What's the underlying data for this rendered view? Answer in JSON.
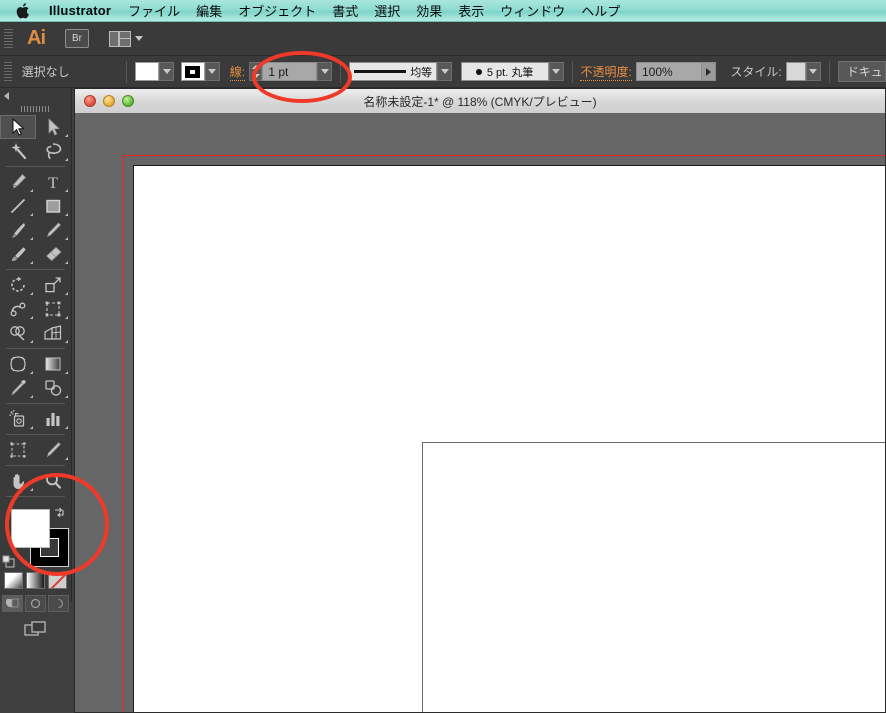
{
  "menubar": {
    "apple_icon": "apple-logo-icon",
    "app_name": "Illustrator",
    "items": [
      {
        "label": "ファイル"
      },
      {
        "label": "編集"
      },
      {
        "label": "オブジェクト"
      },
      {
        "label": "書式"
      },
      {
        "label": "選択"
      },
      {
        "label": "効果"
      },
      {
        "label": "表示"
      },
      {
        "label": "ウィンドウ"
      },
      {
        "label": "ヘルプ"
      }
    ]
  },
  "appbar": {
    "logo": "Ai",
    "bridge_label": "Br",
    "arrange_icon": "arrange-documents-icon"
  },
  "controlbar": {
    "selection_status": "選択なし",
    "fill_label": "fill-swatch",
    "stroke_swatch_label": "stroke-swatch",
    "stroke_label": "線:",
    "stroke_weight": "1 pt",
    "stroke_profile": "均等",
    "brush": "5 pt. 丸筆",
    "opacity_label": "不透明度:",
    "opacity_value": "100%",
    "style_label": "スタイル:",
    "document_button": "ドキュ"
  },
  "document": {
    "title": "名称未設定-1* @ 118% (CMYK/プレビュー)",
    "zoom": "118%",
    "color_mode": "CMYK",
    "view_mode": "プレビュー",
    "traffic_lights": [
      "close",
      "minimize",
      "zoom"
    ]
  },
  "tools": {
    "rows": [
      [
        {
          "name": "selection-tool",
          "active": true
        },
        {
          "name": "direct-selection-tool",
          "active": false
        }
      ],
      [
        {
          "name": "magic-wand-tool",
          "active": false
        },
        {
          "name": "lasso-tool",
          "active": false
        }
      ],
      [
        {
          "name": "pen-tool",
          "active": false
        },
        {
          "name": "type-tool",
          "active": false
        }
      ],
      [
        {
          "name": "line-segment-tool",
          "active": false
        },
        {
          "name": "rectangle-tool",
          "active": false
        }
      ],
      [
        {
          "name": "paintbrush-tool",
          "active": false
        },
        {
          "name": "pencil-tool",
          "active": false
        }
      ],
      [
        {
          "name": "blob-brush-tool",
          "active": false
        },
        {
          "name": "eraser-tool",
          "active": false
        }
      ],
      [
        {
          "name": "rotate-tool",
          "active": false
        },
        {
          "name": "scale-tool",
          "active": false
        }
      ],
      [
        {
          "name": "width-tool",
          "active": false
        },
        {
          "name": "free-transform-tool",
          "active": false
        }
      ],
      [
        {
          "name": "shape-builder-tool",
          "active": false
        },
        {
          "name": "perspective-grid-tool",
          "active": false
        }
      ],
      [
        {
          "name": "mesh-tool",
          "active": false
        },
        {
          "name": "gradient-tool",
          "active": false
        }
      ],
      [
        {
          "name": "eyedropper-tool",
          "active": false
        },
        {
          "name": "blend-tool",
          "active": false
        }
      ],
      [
        {
          "name": "symbol-sprayer-tool",
          "active": false
        },
        {
          "name": "column-graph-tool",
          "active": false
        }
      ],
      [
        {
          "name": "artboard-tool",
          "active": false
        },
        {
          "name": "slice-tool",
          "active": false
        }
      ],
      [
        {
          "name": "hand-tool",
          "active": false
        },
        {
          "name": "zoom-tool",
          "active": false
        }
      ]
    ],
    "fill_color": "#ffffff",
    "stroke_color": "#000000",
    "color_mode_buttons": [
      "color-button",
      "gradient-button",
      "none-button"
    ],
    "draw_modes": [
      "draw-normal",
      "draw-behind",
      "draw-inside"
    ],
    "screen_mode": "change-screen-mode"
  },
  "canvas": {
    "artboard_guide_color": "#ee2222",
    "page_background": "#ffffff",
    "canvas_background": "#666666",
    "object": {
      "name": "drawn-rectangle",
      "stroke": "#6b6b6b"
    }
  },
  "annotations": [
    {
      "name": "stroke-weight-highlight",
      "color": "#ef3a2a"
    },
    {
      "name": "fill-stroke-highlight",
      "color": "#ef3a2a"
    }
  ]
}
